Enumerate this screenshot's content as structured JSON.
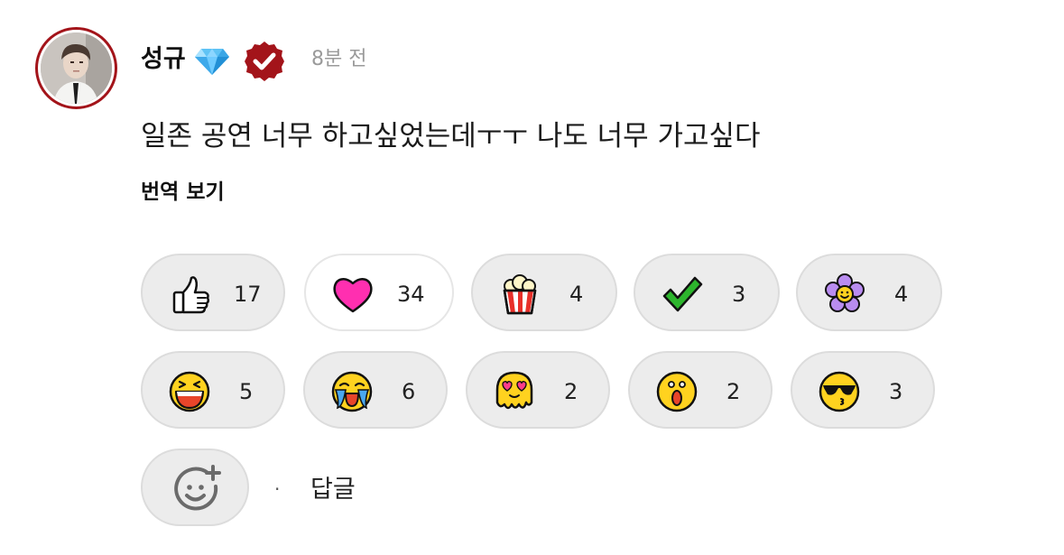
{
  "comment": {
    "username": "성규",
    "timestamp": "8분 전",
    "text": "일존 공연 너무 하고싶었는데ㅜㅜ 나도 너무 가고싶다",
    "translate_label": "번역 보기",
    "reply_label": "답글",
    "separator": "·"
  },
  "icons": {
    "avatar": "profile-photo",
    "badge": "diamond-icon",
    "verified": "verified-check-icon",
    "add_reaction": "add-emoji-icon"
  },
  "colors": {
    "accent_red": "#a3141a",
    "pill_background": "#ececec",
    "selected_pill_background": "#ffffff",
    "heart_pink": "#ff2fb0",
    "check_green": "#2db52d",
    "flower_purple": "#b98cf0",
    "face_yellow": "#ffd21f"
  },
  "reactions": [
    {
      "icon": "thumbs-up-icon",
      "count": "17",
      "selected": false
    },
    {
      "icon": "heart-icon",
      "count": "34",
      "selected": true
    },
    {
      "icon": "popcorn-icon",
      "count": "4",
      "selected": false
    },
    {
      "icon": "checkmark-icon",
      "count": "3",
      "selected": false
    },
    {
      "icon": "flower-icon",
      "count": "4",
      "selected": false
    },
    {
      "icon": "laughing-face-icon",
      "count": "5",
      "selected": false
    },
    {
      "icon": "crying-face-icon",
      "count": "6",
      "selected": false
    },
    {
      "icon": "melting-heart-eyes-face-icon",
      "count": "2",
      "selected": false
    },
    {
      "icon": "shocked-face-icon",
      "count": "2",
      "selected": false
    },
    {
      "icon": "sunglasses-kiss-face-icon",
      "count": "3",
      "selected": false
    }
  ]
}
